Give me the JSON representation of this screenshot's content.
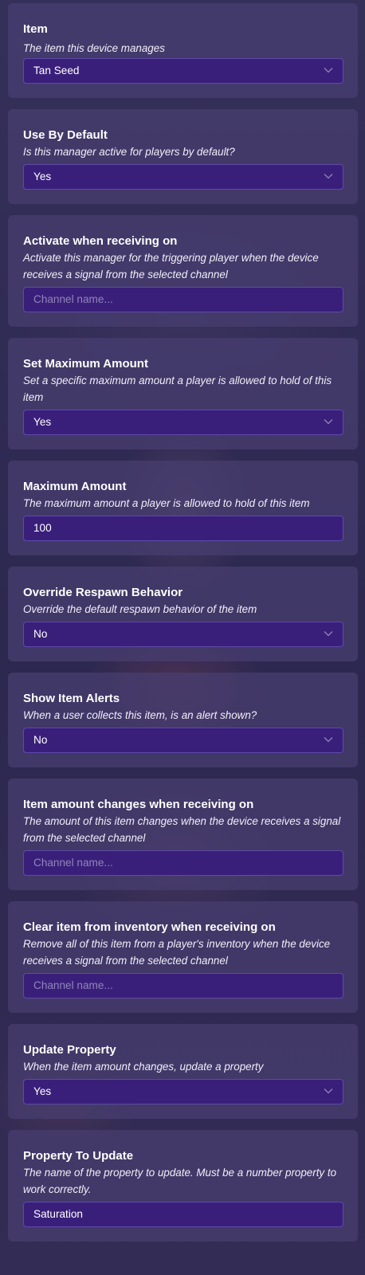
{
  "settings": [
    {
      "label": "Item",
      "description": "The item this device manages",
      "field_type": "select",
      "value": "Tan Seed"
    },
    {
      "label": "Use By Default",
      "description": "Is this manager active for players by default?",
      "field_type": "select",
      "value": "Yes"
    },
    {
      "label": "Activate when receiving on",
      "description": "Activate this manager for the triggering player when the device receives a signal from the selected channel",
      "field_type": "text",
      "value": "",
      "placeholder": "Channel name..."
    },
    {
      "label": "Set Maximum Amount",
      "description": "Set a specific maximum amount a player is allowed to hold of this item",
      "field_type": "select",
      "value": "Yes"
    },
    {
      "label": "Maximum Amount",
      "description": "The maximum amount a player is allowed to hold of this item",
      "field_type": "text",
      "value": "100"
    },
    {
      "label": "Override Respawn Behavior",
      "description": "Override the default respawn behavior of the item",
      "field_type": "select",
      "value": "No"
    },
    {
      "label": "Show Item Alerts",
      "description": "When a user collects this item, is an alert shown?",
      "field_type": "select",
      "value": "No"
    },
    {
      "label": "Item amount changes when receiving on",
      "description": "The amount of this item changes when the device receives a signal from the selected channel",
      "field_type": "text",
      "value": "",
      "placeholder": "Channel name..."
    },
    {
      "label": "Clear item from inventory when receiving on",
      "description": "Remove all of this item from a player's inventory when the device receives a signal from the selected channel",
      "field_type": "text",
      "value": "",
      "placeholder": "Channel name..."
    },
    {
      "label": "Update Property",
      "description": "When the item amount changes, update a property",
      "field_type": "select",
      "value": "Yes"
    },
    {
      "label": "Property To Update",
      "description": "The name of the property to update. Must be a number property to work correctly.",
      "field_type": "text",
      "value": "Saturation"
    }
  ],
  "icons": {
    "dropdown": "chevron-down-icon"
  },
  "colors": {
    "panel_background": "#2f2a4d",
    "card_background": "#483e70",
    "field_background": "#3a1f7a",
    "field_border": "#5d4aa8",
    "placeholder": "#8f85b8"
  }
}
